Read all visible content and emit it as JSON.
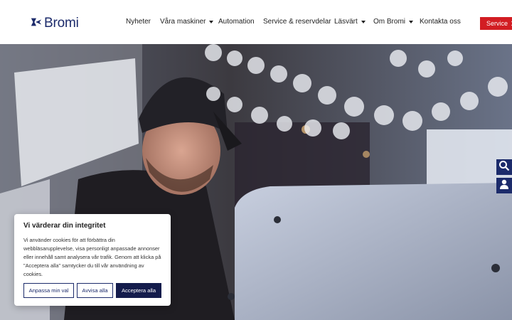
{
  "brand": {
    "name": "Bromi",
    "color": "#1c2b6b",
    "icon": "bromi-logo-icon"
  },
  "nav": {
    "items": [
      {
        "label": "Nyheter",
        "dropdown": false
      },
      {
        "label": "Våra maskiner",
        "dropdown": true
      },
      {
        "label": "Automation",
        "dropdown": false
      },
      {
        "label": "Service & reservdelar",
        "dropdown": false
      },
      {
        "label": "Läsvärt",
        "dropdown": true
      },
      {
        "label": "Om Bromi",
        "dropdown": true
      },
      {
        "label": "Kontakta oss",
        "dropdown": false
      }
    ],
    "service_button": {
      "label": "Service",
      "icon": "tools-cross-icon",
      "color": "#d21d23"
    }
  },
  "side_tabs": [
    {
      "icon": "search-icon"
    },
    {
      "icon": "user-icon"
    }
  ],
  "cookie": {
    "title": "Vi värderar din integritet",
    "text": "Vi använder cookies för att förbättra din webbläsarupplevelse, visa personligt anpassade annonser eller innehåll samt analysera vår trafik. Genom att klicka på \"Acceptera alla\" samtycker du till vår användning av cookies.",
    "buttons": {
      "customize": "Anpassa min val",
      "reject": "Avvisa alla",
      "accept": "Acceptera alla"
    }
  }
}
